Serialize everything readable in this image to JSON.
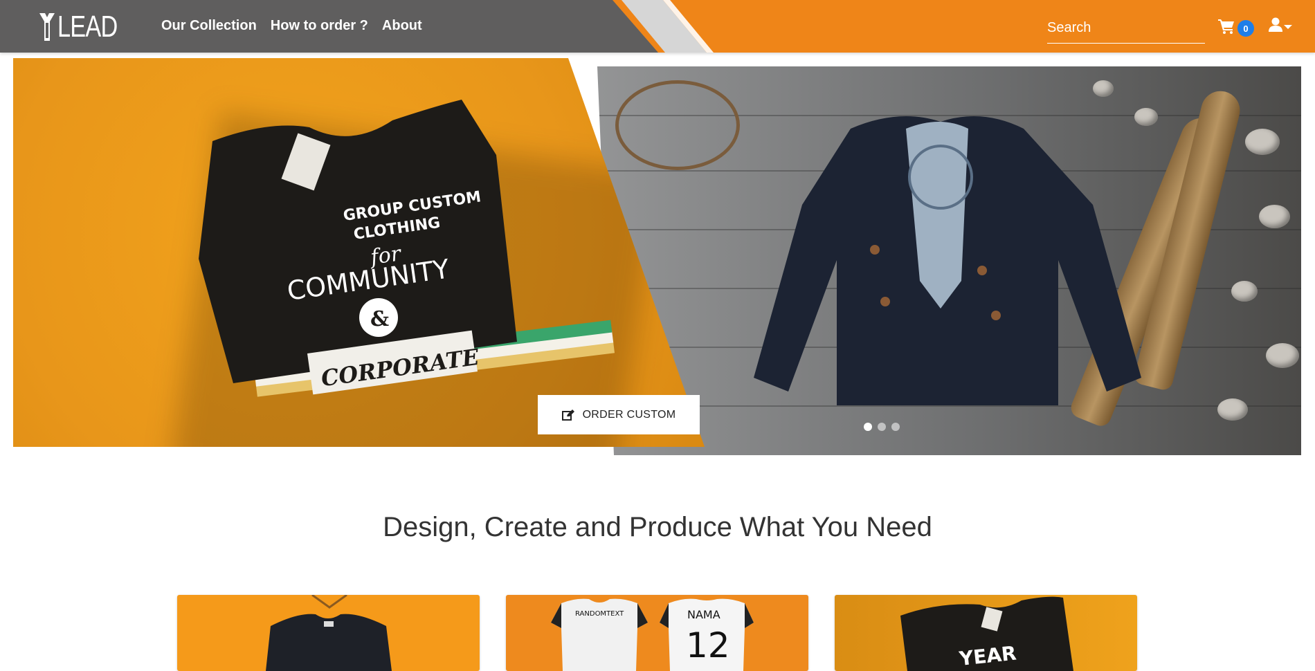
{
  "navbar": {
    "logo_text": "LEAD",
    "links": [
      "Our Collection",
      "How to order ?",
      "About"
    ],
    "search_placeholder": "Search",
    "cart_count": "0",
    "colors": {
      "dark": "#5f5e5e",
      "accent": "#ef8518",
      "badge": "#1e7ee8"
    }
  },
  "hero": {
    "order_button_label": "ORDER CUSTOM",
    "slides_total": 3,
    "active_slide": 1,
    "tshirt_print": {
      "line1": "GROUP CUSTOM",
      "line2": "CLOTHING",
      "line3": "for",
      "line4": "COMMUNITY",
      "line5": "&",
      "line6": "CORPORATE"
    }
  },
  "section": {
    "title": "Design, Create and Produce What You Need"
  },
  "cards": {
    "jersey_text": "RANDOMTEXT",
    "jersey_name": "NAMA",
    "jersey_number": "12",
    "card3_text": "YEAR"
  }
}
